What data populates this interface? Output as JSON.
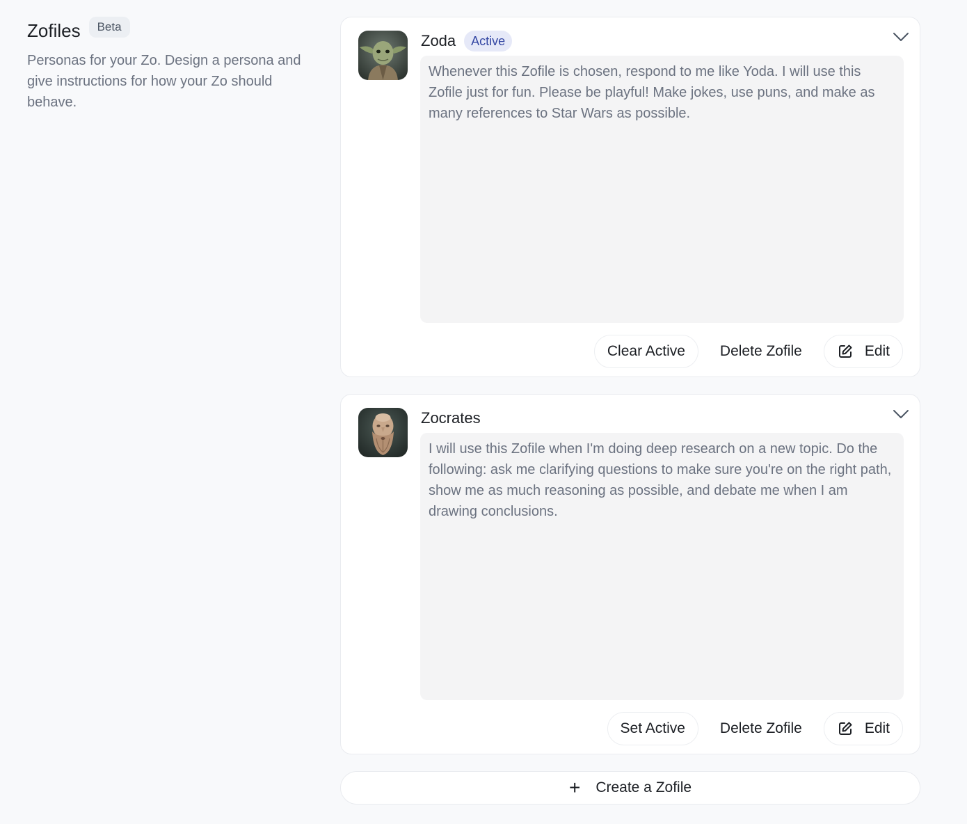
{
  "intro": {
    "title": "Zofiles",
    "badge": "Beta",
    "description": "Personas for your Zo. Design a persona and give instructions for how your Zo should behave."
  },
  "zofiles": [
    {
      "name": "Zoda",
      "status_badge": "Active",
      "avatar": "yoda-portrait",
      "instructions": "Whenever this Zofile is chosen, respond to me like Yoda. I will use this Zofile just for fun. Please be playful! Make jokes, use puns, and make as many references to Star Wars as possible.",
      "actions": {
        "toggle_label": "Clear Active",
        "delete_label": "Delete Zofile",
        "edit_label": "Edit"
      }
    },
    {
      "name": "Zocrates",
      "status_badge": "",
      "avatar": "socrates-bust",
      "instructions": "I will use this Zofile when I'm doing deep research on a new topic. Do the following: ask me clarifying questions to make sure you're on the right path, show me as much reasoning as possible, and debate me when I am drawing conclusions.",
      "actions": {
        "toggle_label": "Set Active",
        "delete_label": "Delete Zofile",
        "edit_label": "Edit"
      }
    }
  ],
  "create": {
    "label": "Create a Zofile",
    "icon": "plus-icon"
  },
  "icons": {
    "expand": "chevron-down-icon",
    "edit": "edit-icon"
  },
  "colors": {
    "active_badge_bg": "#e6e9f8",
    "active_badge_text": "#3346a3",
    "page_bg": "#f8f9fb"
  }
}
